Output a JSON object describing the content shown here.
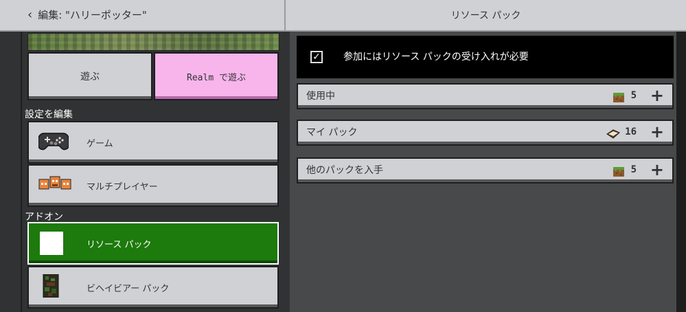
{
  "header": {
    "back_label": "編集: \"ハリーポッター\"",
    "title": "リソース パック"
  },
  "world": {
    "play_label": "遊ぶ",
    "realm_label": "Realm で遊ぶ"
  },
  "settings": {
    "section_label": "設定を編集",
    "items": [
      {
        "label": "ゲーム",
        "icon": "controller-icon"
      },
      {
        "label": "マルチプレイヤー",
        "icon": "multiplayer-icon"
      }
    ]
  },
  "addons": {
    "section_label": "アドオン",
    "items": [
      {
        "label": "リソース パック",
        "icon": "resource-pack-icon",
        "selected": true
      },
      {
        "label": "ビヘイビアー パック",
        "icon": "behavior-pack-icon",
        "selected": false
      }
    ]
  },
  "resource_packs": {
    "require_notice": "参加にはリソース パックの受け入れが必要",
    "require_checked": true,
    "rows": [
      {
        "label": "使用中",
        "count": "5",
        "icon": "grass-block-icon"
      },
      {
        "label": "マイ パック",
        "count": "16",
        "icon": "book-icon"
      },
      {
        "label": "他のパックを入手",
        "count": "5",
        "icon": "grass-block-icon"
      }
    ]
  },
  "colors": {
    "accent_green": "#1d7a0c",
    "realm_pink": "#f7b5ec",
    "button_grey": "#d0d1d4",
    "background_dark": "#313233",
    "panel_dark": "#48494a"
  }
}
